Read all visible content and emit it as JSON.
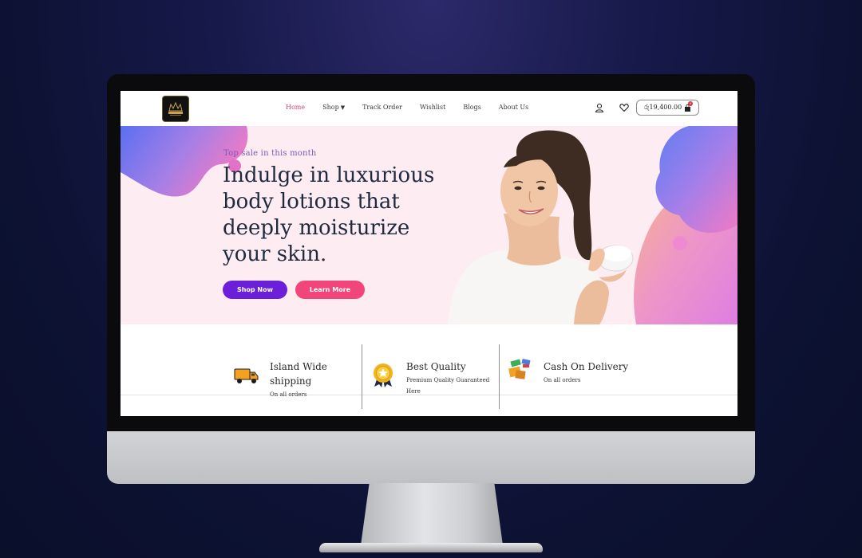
{
  "header": {
    "nav": [
      {
        "label": "Home",
        "active": true
      },
      {
        "label": "Shop",
        "dropdown": true
      },
      {
        "label": "Track Order"
      },
      {
        "label": "Wishlist"
      },
      {
        "label": "Blogs"
      },
      {
        "label": "About Us"
      }
    ],
    "cart_total": "රු19,400.00",
    "cart_count": "0"
  },
  "hero": {
    "eyebrow": "Top sale in this month",
    "title": "Indulge in luxurious body lotions that deeply moisturize your skin.",
    "shop_button": "Shop Now",
    "learn_button": "Learn More"
  },
  "features": [
    {
      "icon": "delivery-truck-icon",
      "title": "Island Wide shipping",
      "subtitle": "On all orders"
    },
    {
      "icon": "quality-badge-icon",
      "title": "Best Quality",
      "subtitle": "Premium Quality Guaranteed Here"
    },
    {
      "icon": "cash-delivery-icon",
      "title": "Cash On Delivery",
      "subtitle": "On all orders"
    }
  ],
  "colors": {
    "nav_active": "#d24a71",
    "eyebrow": "#7b57b5",
    "shop_button": "#6b1fd9",
    "learn_button": "#f2457c",
    "hero_background": "#fdecf2"
  }
}
